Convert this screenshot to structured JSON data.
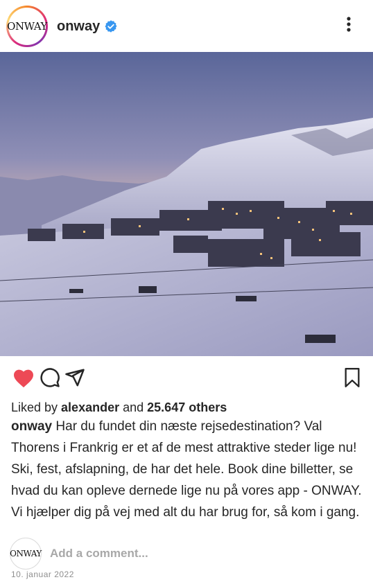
{
  "header": {
    "avatar_logo": "ONWAY",
    "username": "onway",
    "verified_icon": "verified-badge-icon",
    "more_icon": "more-vertical-icon"
  },
  "photo": {
    "subject": "Snowy alpine ski resort at dusk"
  },
  "actions": {
    "like_icon": "heart-filled-icon",
    "comment_icon": "comment-icon",
    "share_icon": "share-icon",
    "save_icon": "bookmark-icon",
    "like_color": "#ed4956"
  },
  "likes": {
    "prefix": "Liked by ",
    "user": "alexander",
    "middle": " and ",
    "count": "25.647 others"
  },
  "caption": {
    "user": "onway",
    "text": "Har du fundet din næste rejsedestination? Val Thorens i Frankrig er et af de mest attraktive steder lige nu! Ski, fest, afslapning, de har det hele. Book dine billetter, se hvad du kan opleve dernede lige nu på vores app - ONWAY. Vi hjælper dig på vej med alt du har brug for, så kom i gang."
  },
  "comment": {
    "placeholder": "Add a comment..."
  },
  "date": "10. januar 2022"
}
